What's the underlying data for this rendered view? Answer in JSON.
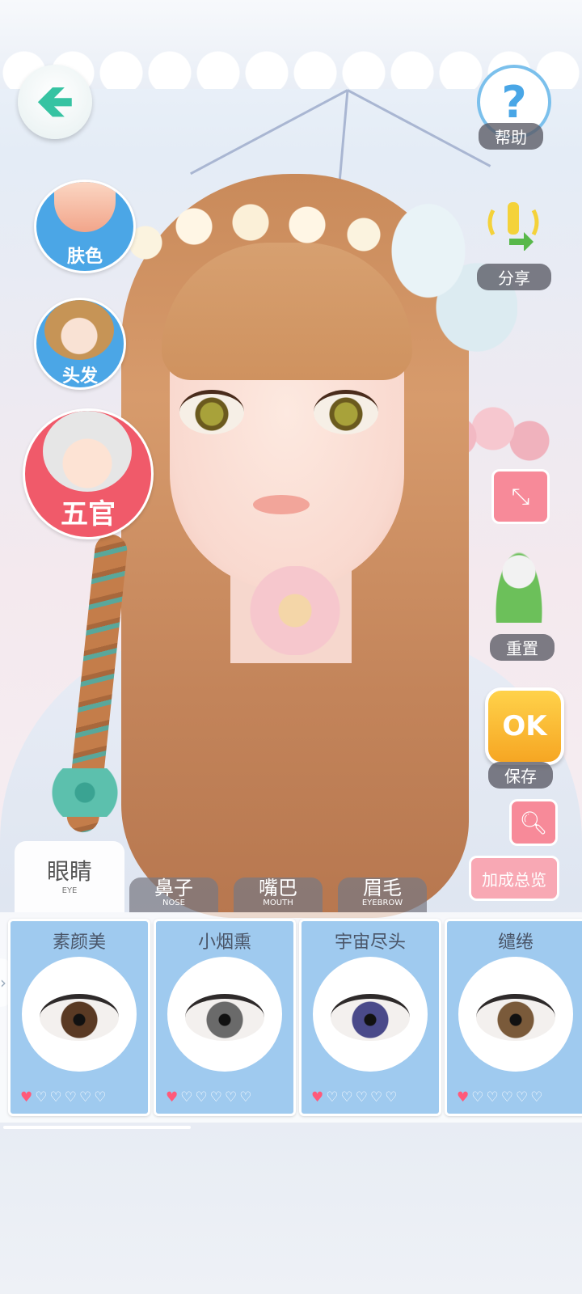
{
  "nav": {
    "help_label": "帮助",
    "share_label": "分享",
    "reset_label": "重置",
    "save_label": "保存",
    "ok_text": "OK",
    "overview_label": "加成总览"
  },
  "side_menu": {
    "skin_label": "肤色",
    "hair_label": "头发",
    "features_label": "五官"
  },
  "tabs": [
    {
      "cn": "眼睛",
      "en": "EYE",
      "active": true
    },
    {
      "cn": "鼻子",
      "en": "NOSE",
      "active": false
    },
    {
      "cn": "嘴巴",
      "en": "MOUTH",
      "active": false
    },
    {
      "cn": "眉毛",
      "en": "EYEBROW",
      "active": false
    }
  ],
  "cards": [
    {
      "title": "素颜美",
      "iris_color": "#5a3a24",
      "rating": 1,
      "max_rating": 6
    },
    {
      "title": "小烟熏",
      "iris_color": "#6a6a6a",
      "rating": 1,
      "max_rating": 6
    },
    {
      "title": "宇宙尽头",
      "iris_color": "#4a4a8a",
      "rating": 1,
      "max_rating": 6
    },
    {
      "title": "缱绻",
      "iris_color": "#7a5a3a",
      "rating": 1,
      "max_rating": 6
    }
  ],
  "icons": {
    "back": "arrow-left-icon",
    "help": "question-mark-icon",
    "share": "signal-share-icon",
    "collapse": "collapse-arrows-icon",
    "reset": "bird-figure-icon",
    "search": "magnifier-icon"
  }
}
